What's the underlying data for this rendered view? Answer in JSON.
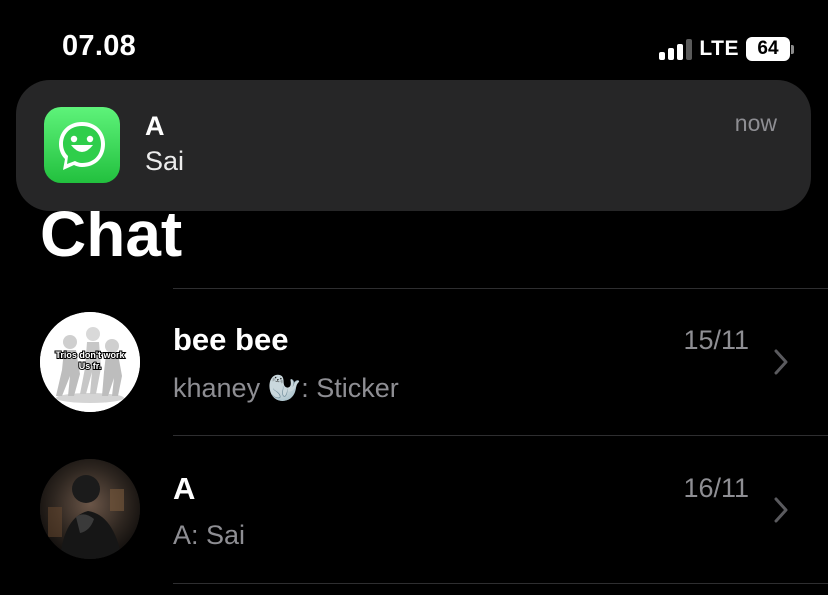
{
  "status_bar": {
    "time": "07.08",
    "network": "LTE",
    "battery": "64"
  },
  "notification": {
    "app_icon": "whatsapp-icon",
    "sender": "A",
    "message": "Sai",
    "time": "now"
  },
  "page": {
    "title": "Chat"
  },
  "chats": [
    {
      "name": "bee bee",
      "preview_prefix": "khaney ",
      "preview_emoji": "🦭",
      "preview_suffix": ": Sticker",
      "date": "15/11",
      "avatar_text_1": "Trios don't work",
      "avatar_text_2": "Us fr."
    },
    {
      "name": "A",
      "preview": "A: Sai",
      "date": "16/11"
    }
  ],
  "colors": {
    "background": "#000000",
    "banner": "#262627",
    "secondary_text": "#8e8e93",
    "whatsapp_green": "#25d366"
  }
}
